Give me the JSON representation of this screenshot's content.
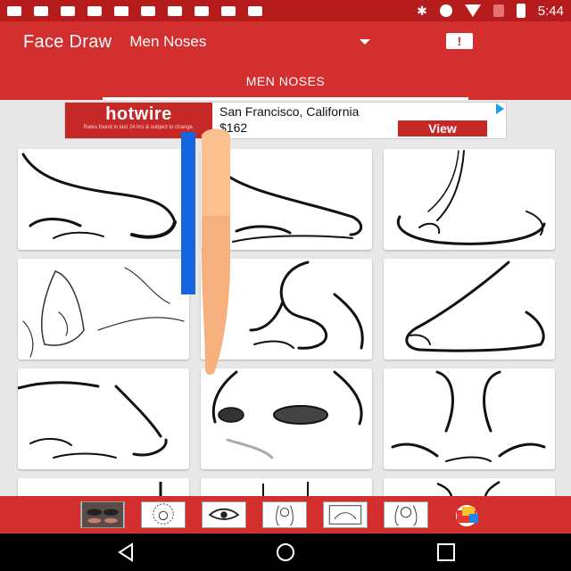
{
  "status_bar": {
    "time": "5:44"
  },
  "app_bar": {
    "title": "Face Draw",
    "category_spinner": "Men Noses",
    "report_icon": "feedback-icon"
  },
  "tabs": [
    {
      "label": "MEN NOSES",
      "selected": true
    }
  ],
  "ad": {
    "brand": "hotwire",
    "fine_print": "Rates found in last 24 hrs & subject to change.",
    "city": "San Francisco, California",
    "price": "$162",
    "cta": "View"
  },
  "colors": {
    "status_bar": "#b71c1c",
    "app_bar": "#d32f2f",
    "scroll_indicator": "#1565e0",
    "accent": "#c62828"
  },
  "grid": {
    "items": [
      "nose-drawing-1",
      "nose-drawing-2",
      "nose-drawing-3",
      "nose-drawing-4",
      "nose-drawing-5",
      "nose-drawing-6",
      "nose-drawing-7",
      "nose-drawing-8",
      "nose-drawing-9",
      "nose-drawing-10",
      "nose-drawing-11",
      "nose-drawing-12"
    ]
  },
  "bottom_apps": [
    "eyes-app-icon",
    "afro-app-icon",
    "eye-drawing-app-icon",
    "girl-drawing-app-icon",
    "sketch-app-icon",
    "anime-app-icon",
    "paint-app-icon"
  ],
  "nav_bar": [
    "back-icon",
    "home-icon",
    "recents-icon"
  ]
}
